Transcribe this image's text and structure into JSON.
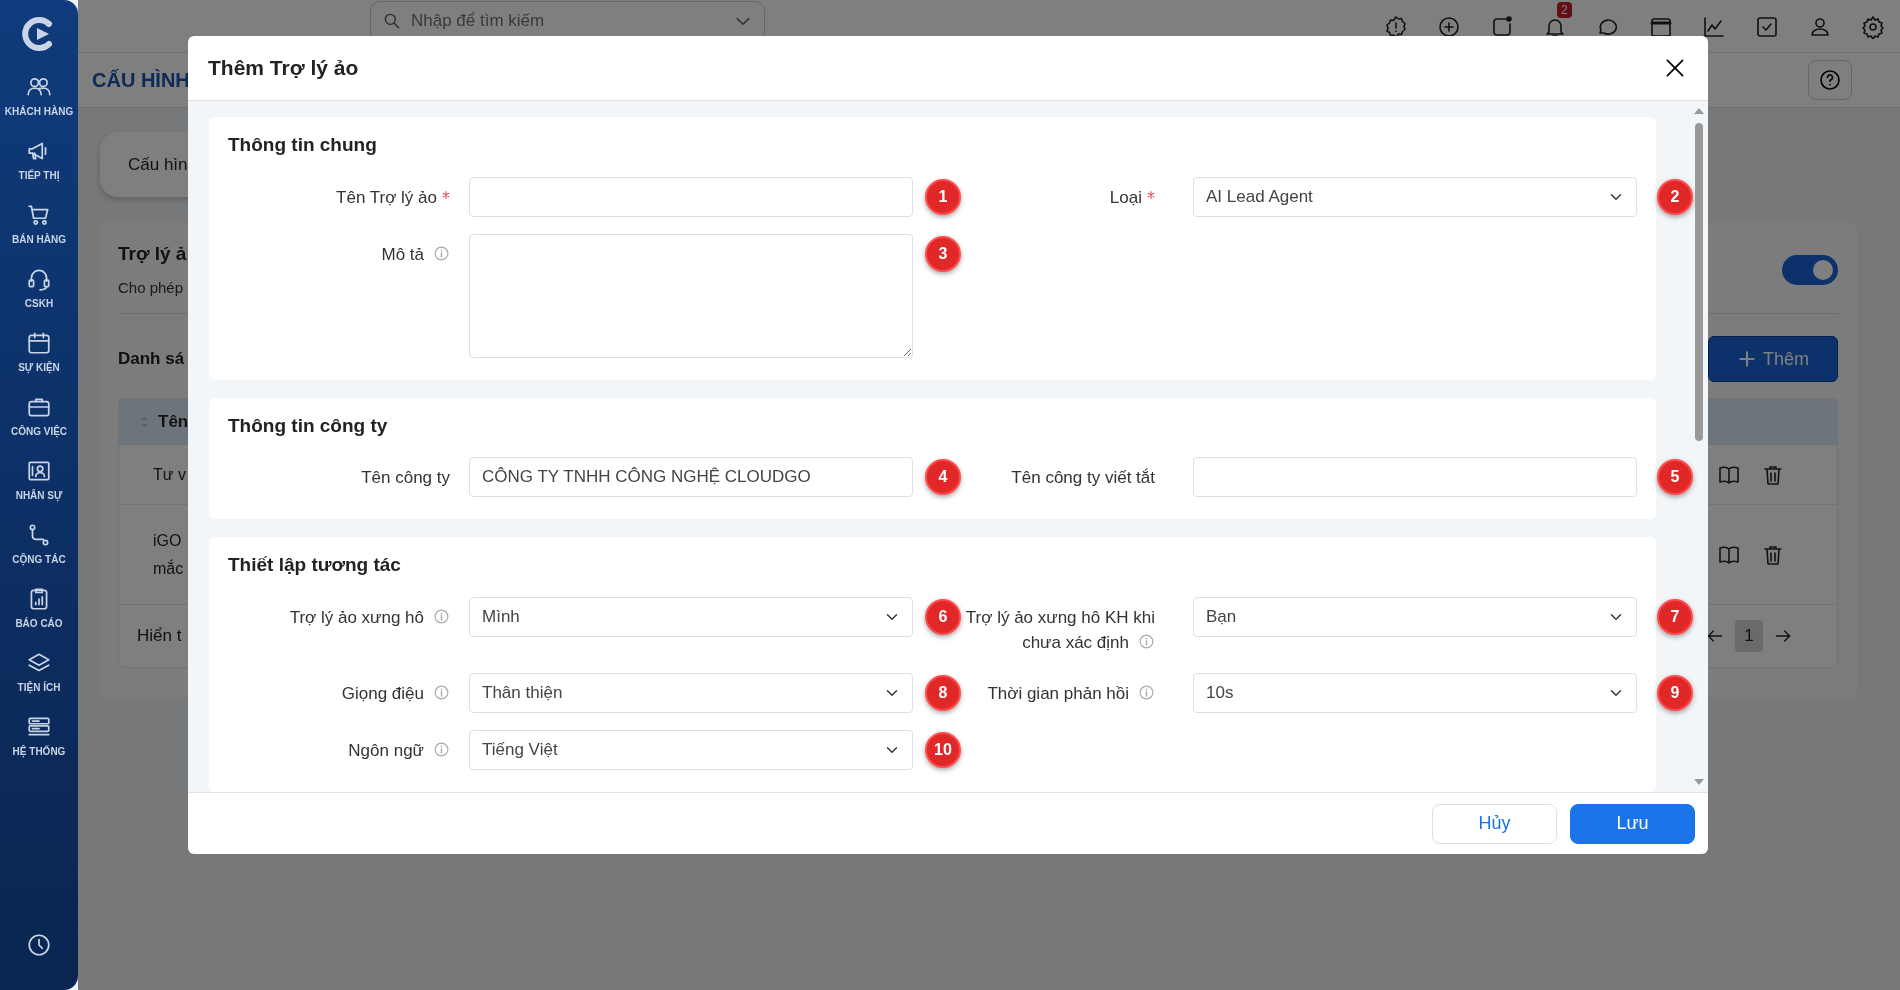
{
  "sidebar": {
    "items": [
      {
        "label": "KHÁCH HÀNG"
      },
      {
        "label": "TIẾP THỊ"
      },
      {
        "label": "BÁN HÀNG"
      },
      {
        "label": "CSKH"
      },
      {
        "label": "SỰ KIỆN"
      },
      {
        "label": "CÔNG VIỆC"
      },
      {
        "label": "NHÂN SỰ"
      },
      {
        "label": "CỘNG TÁC"
      },
      {
        "label": "BÁO CÁO"
      },
      {
        "label": "TIỆN ÍCH"
      },
      {
        "label": "HỆ THỐNG"
      }
    ]
  },
  "top_bar": {
    "search": {
      "placeholder": "Nhập để tìm kiếm"
    },
    "notification_count": "2"
  },
  "page": {
    "title": "CẤU HÌNH",
    "tab": "Cấu hìn",
    "card": {
      "title": "Trợ lý ả",
      "description": "Cho phép",
      "toggle": {
        "on": true
      }
    },
    "list": {
      "title": "Danh sá",
      "add_button": "Thêm",
      "table": {
        "column_1": "Tên",
        "rows": [
          {
            "cell": "Tư v"
          },
          {
            "cell": "iGO mắc"
          }
        ]
      },
      "footer": "Hiển t",
      "pagination": {
        "pages": [
          {
            "label": "1",
            "selected": true
          }
        ]
      }
    }
  },
  "modal": {
    "title": "Thêm Trợ lý ảo",
    "sections": [
      {
        "title": "Thông tin chung",
        "rows": [
          [
            {
              "label": "Tên Trợ lý ảo",
              "required": true,
              "info": false,
              "kind": "input",
              "marker": "1"
            },
            {
              "label": "Loại",
              "required": true,
              "info": false,
              "kind": "select",
              "value": "AI Lead Agent",
              "marker": "2"
            }
          ],
          [
            {
              "label": "Mô tả",
              "required": false,
              "info": true,
              "kind": "textarea",
              "marker": "3"
            }
          ]
        ]
      },
      {
        "title": "Thông tin công ty",
        "rows": [
          [
            {
              "label": "Tên công ty",
              "required": false,
              "info": false,
              "kind": "input",
              "value": "CÔNG TY TNHH CÔNG NGHỆ CLOUDGO",
              "marker": "4"
            },
            {
              "label": "Tên công ty viết tắt",
              "required": false,
              "info": false,
              "kind": "input",
              "marker": "5"
            }
          ]
        ]
      },
      {
        "title": "Thiết lập tương tác",
        "rows": [
          [
            {
              "label": "Trợ lý ảo xưng hô",
              "required": false,
              "info": true,
              "kind": "select",
              "value": "Mình",
              "marker": "6"
            },
            {
              "label": "Trợ lý ảo xưng hô KH khi chưa xác định",
              "required": false,
              "info": true,
              "kind": "select",
              "value": "Bạn",
              "marker": "7"
            }
          ],
          [
            {
              "label": "Giọng điệu",
              "required": false,
              "info": true,
              "kind": "select",
              "value": "Thân thiện",
              "marker": "8"
            },
            {
              "label": "Thời gian phản hồi",
              "required": false,
              "info": true,
              "kind": "select",
              "value": "10s",
              "marker": "9"
            }
          ],
          [
            {
              "label": "Ngôn ngữ",
              "required": false,
              "info": true,
              "kind": "select",
              "value": "Tiếng Việt",
              "marker": "10"
            }
          ]
        ]
      }
    ],
    "buttons": [
      {
        "label": "Hủy",
        "kind": "secondary"
      },
      {
        "label": "Lưu",
        "kind": "primary"
      }
    ]
  }
}
